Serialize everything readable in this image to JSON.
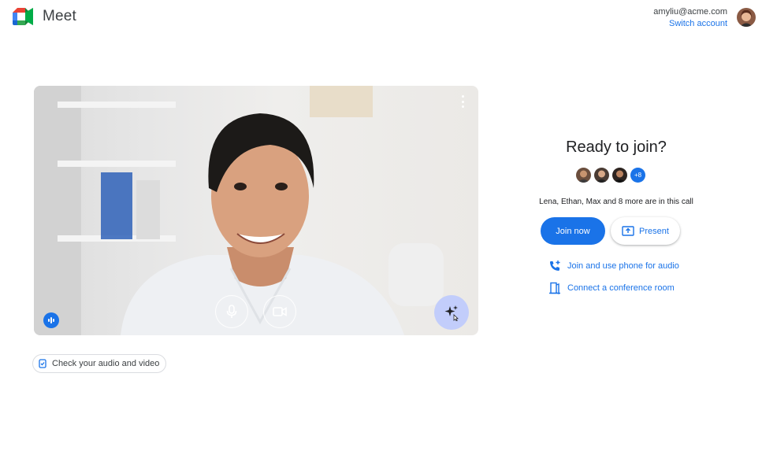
{
  "app": {
    "name": "Meet"
  },
  "account": {
    "email": "amyliu@acme.com",
    "switch_label": "Switch account"
  },
  "preview": {
    "effects_icon": "sparkle-icon",
    "mic_icon": "mic-icon",
    "camera_icon": "camera-icon"
  },
  "check_audio_video": {
    "label": "Check your audio and video"
  },
  "join_panel": {
    "heading": "Ready to join?",
    "participants_more": "+8",
    "in_call_text": "Lena, Ethan, Max and 8 more are in this call",
    "join_label": "Join now",
    "present_label": "Present",
    "phone_link": "Join and use phone for audio",
    "room_link": "Connect a conference room"
  },
  "colors": {
    "accent": "#1a73e8",
    "effects_bg": "#c2cdfb"
  }
}
